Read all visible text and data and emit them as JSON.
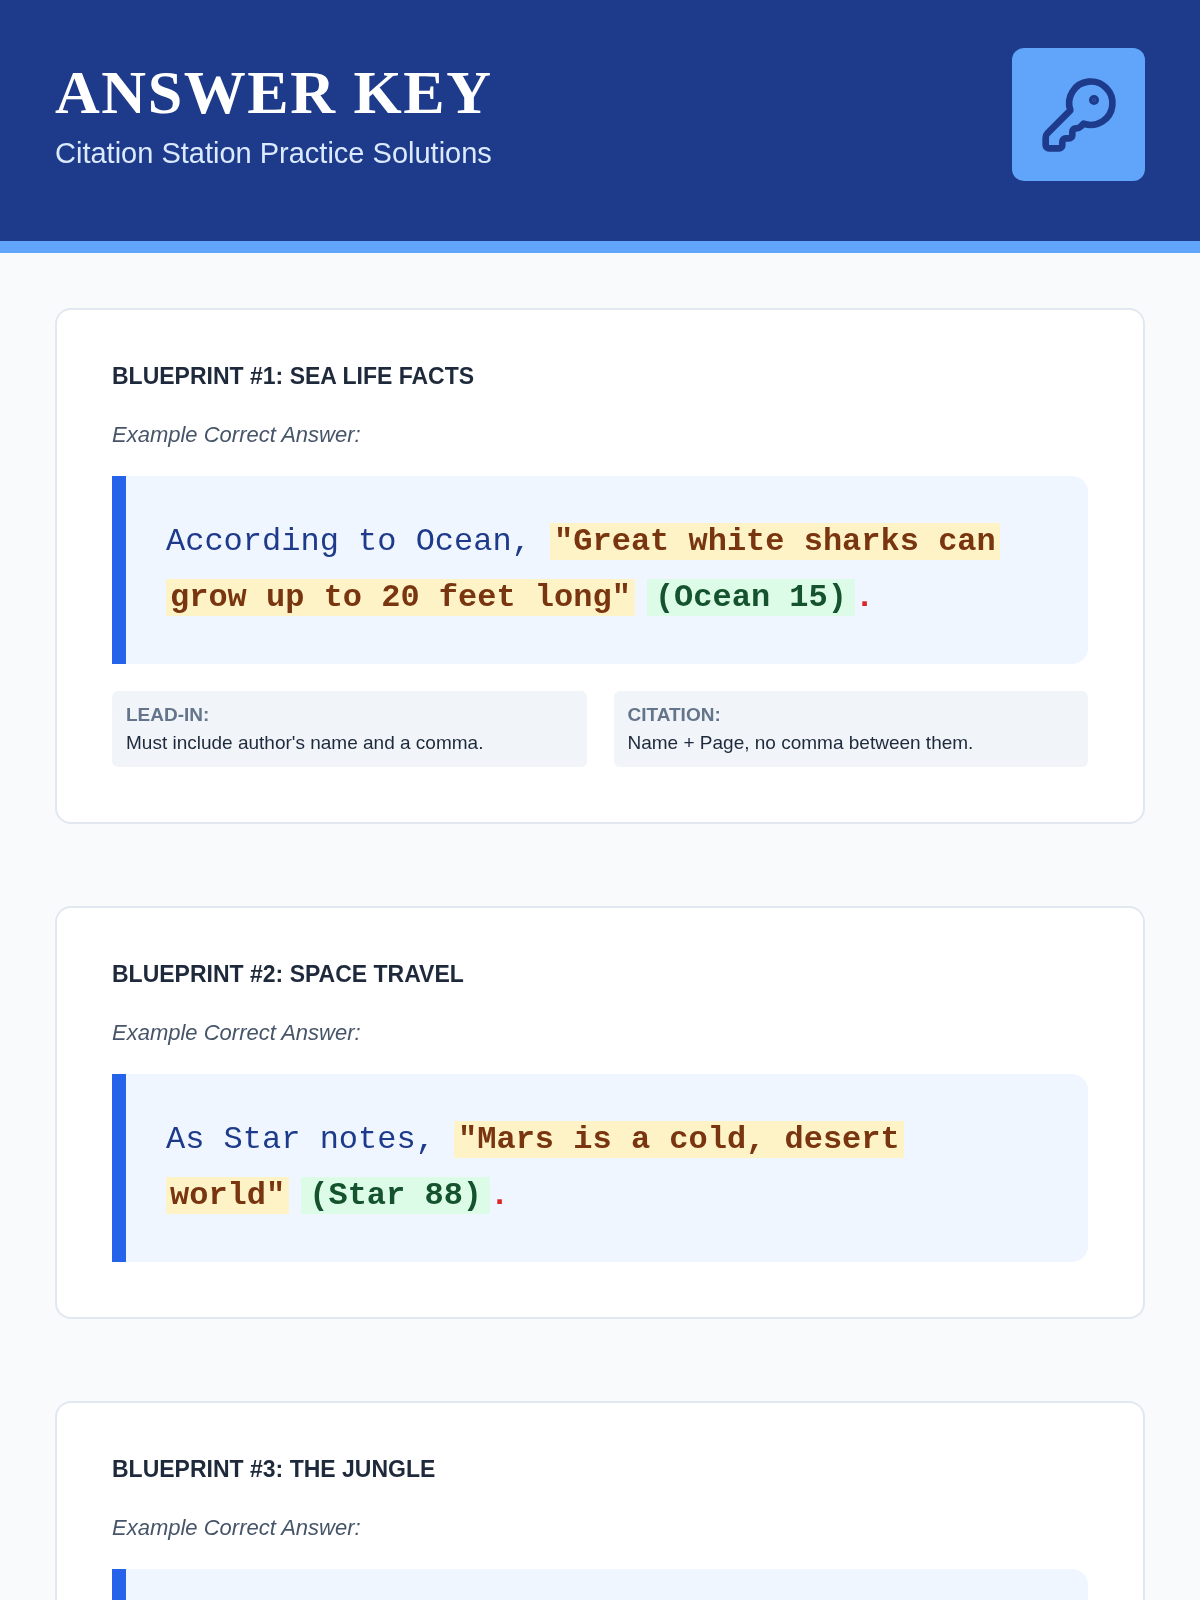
{
  "header": {
    "title": "ANSWER KEY",
    "subtitle": "Citation Station Practice Solutions"
  },
  "blueprints": [
    {
      "heading": "BLUEPRINT #1: SEA LIFE FACTS",
      "label": "Example Correct Answer:",
      "answer": [
        {
          "kind": "lead",
          "text": "According to Ocean,"
        },
        {
          "kind": "quote",
          "text": "\"Great white sharks can grow up to 20 feet long\""
        },
        {
          "kind": "citation",
          "text": "(Ocean 15)"
        },
        {
          "kind": "period",
          "text": "."
        }
      ],
      "notes": [
        {
          "title": "LEAD-IN:",
          "text": "Must include author's name and a comma."
        },
        {
          "title": "CITATION:",
          "text": "Name + Page, no comma between them."
        }
      ]
    },
    {
      "heading": "BLUEPRINT #2: SPACE TRAVEL",
      "label": "Example Correct Answer:",
      "answer": [
        {
          "kind": "lead",
          "text": "As Star notes,"
        },
        {
          "kind": "quote",
          "text": "\"Mars is a cold, desert world\""
        },
        {
          "kind": "citation",
          "text": "(Star 88)"
        },
        {
          "kind": "period",
          "text": "."
        }
      ]
    },
    {
      "heading": "BLUEPRINT #3: THE JUNGLE",
      "label": "Example Correct Answer:"
    }
  ]
}
